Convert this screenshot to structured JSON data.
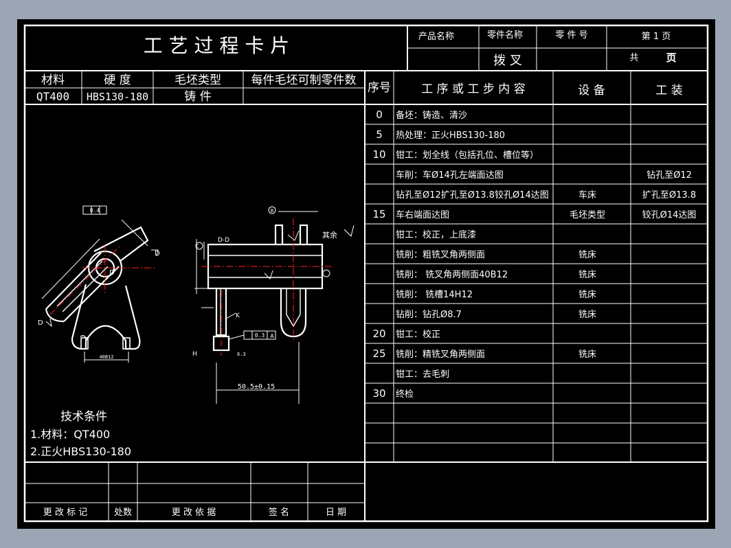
{
  "header": {
    "card_title": "工 艺 过 程 卡 片",
    "product_name_label": "产品名称",
    "part_name_label": "零件名称",
    "part_no_label": "零 件 号",
    "page_label": "第 1 页",
    "part_name": "拨 叉",
    "total_prefix": "共",
    "total_suffix": "页"
  },
  "material_table": {
    "headers": [
      "材料",
      "硬 度",
      "毛坯类型",
      "每件毛坯可制零件数"
    ],
    "values": [
      "QT400",
      "HBS130-180",
      "铸 件",
      ""
    ]
  },
  "process_table": {
    "headers": {
      "seq": "序号",
      "content": "工 序 或 工 步 内 容",
      "equipment": "设 备",
      "tooling": "工 装"
    },
    "rows": [
      {
        "seq": "0",
        "content": "备坯：铸造、清沙",
        "equipment": "",
        "tooling": ""
      },
      {
        "seq": "5",
        "content": "热处理：正火HBS130-180",
        "equipment": "",
        "tooling": ""
      },
      {
        "seq": "10",
        "content": "钳工：划全线（包括孔位、槽位等）",
        "equipment": "",
        "tooling": ""
      },
      {
        "seq": "",
        "content": "车削：车Ø14孔左端面达图",
        "equipment": "",
        "tooling": "钻孔至Ø12"
      },
      {
        "seq": "",
        "content": "钻孔至Ø12扩孔至Ø13.8铰孔Ø14达图",
        "equipment": "车床",
        "tooling": "扩孔至Ø13.8"
      },
      {
        "seq": "15",
        "content": "车右端面达图",
        "equipment": "毛坯类型",
        "tooling": "铰孔Ø14达图"
      },
      {
        "seq": "",
        "content": "钳工：校正，上底漆",
        "equipment": "",
        "tooling": ""
      },
      {
        "seq": "",
        "content": "铣削：粗铣叉角两侧面",
        "equipment": "铣床",
        "tooling": ""
      },
      {
        "seq": "",
        "content": "铣削：  铣叉角两侧面40B12",
        "equipment": "铣床",
        "tooling": ""
      },
      {
        "seq": "",
        "content": "铣削：  铣槽14H12",
        "equipment": "铣床",
        "tooling": ""
      },
      {
        "seq": "",
        "content": "钻削：钻孔Ø8.7",
        "equipment": "铣床",
        "tooling": ""
      },
      {
        "seq": "20",
        "content": "钳工：校正",
        "equipment": "",
        "tooling": ""
      },
      {
        "seq": "25",
        "content": "铣削：精铣叉角两侧面",
        "equipment": "铣床",
        "tooling": ""
      },
      {
        "seq": "",
        "content": "钳工：去毛刺",
        "equipment": "",
        "tooling": ""
      },
      {
        "seq": "30",
        "content": "终检",
        "equipment": "",
        "tooling": ""
      },
      {
        "seq": "",
        "content": "",
        "equipment": "",
        "tooling": ""
      },
      {
        "seq": "",
        "content": "",
        "equipment": "",
        "tooling": ""
      },
      {
        "seq": "",
        "content": "",
        "equipment": "",
        "tooling": ""
      }
    ]
  },
  "tech_conditions": {
    "title": "技术条件",
    "items": [
      "1.材料：QT400",
      "2.正火HBS130-180"
    ]
  },
  "revision_block": {
    "labels": [
      "更 改 标 记",
      "处数",
      "更 改 依 据",
      "签   名",
      "日   期"
    ]
  },
  "drawing": {
    "flatness": "0.4",
    "section_label": "D-D",
    "remaining_label": "其余",
    "datum_c": "C",
    "datum_b": "B",
    "datum_a": "A",
    "datum_d": "D",
    "datum_h": "H",
    "label_k": "K",
    "perp_value": "0.3",
    "length_dim": "50.5±0.15",
    "fork_width": "40B12",
    "finish_right": "6.3"
  },
  "colors": {
    "background": "#000000",
    "lines": "#ffffff",
    "centerline": "#ff2020",
    "frame": "#9ba5b4"
  }
}
